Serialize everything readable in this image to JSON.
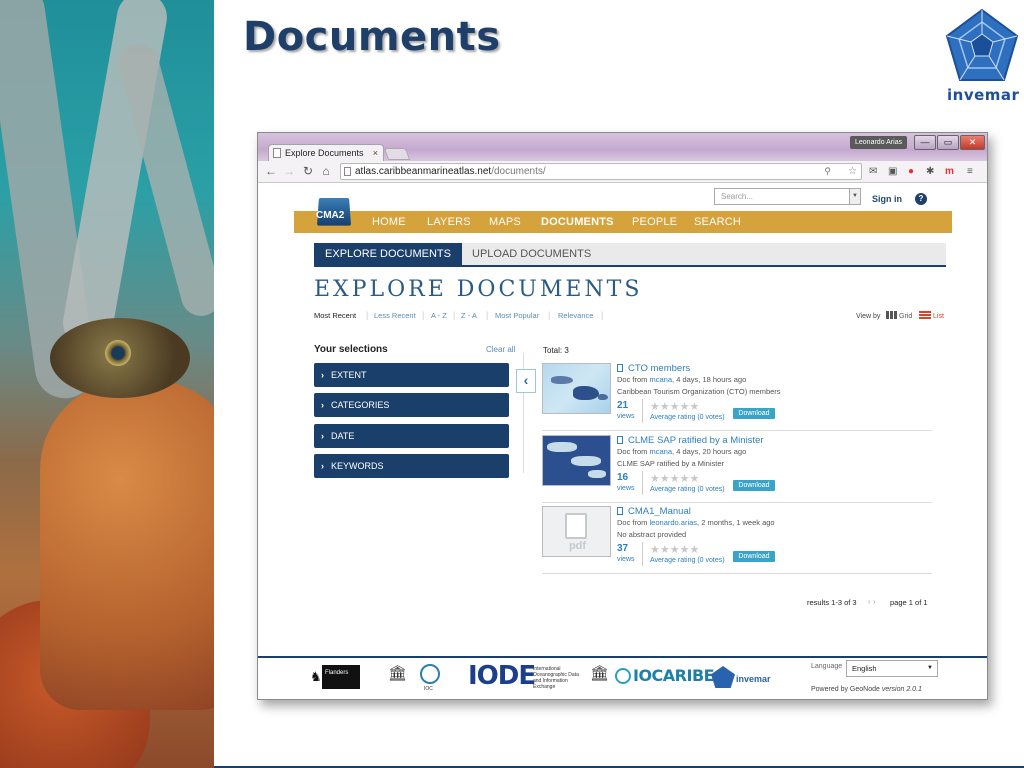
{
  "slide": {
    "title": "Documents",
    "logo_text": "invemar"
  },
  "browser": {
    "user_badge": "Leonardo Arias",
    "tab_title": "Explore Documents",
    "tab_close": "×",
    "url_host": "atlas.caribbeanmarineatlas.net",
    "url_path": "/documents/",
    "window_buttons": {
      "minimize": "—",
      "maximize": "▭",
      "close": "✕"
    }
  },
  "site": {
    "search_placeholder": "Search...",
    "sign_in": "Sign in",
    "help": "?",
    "brand": "CMA2",
    "nav": [
      "HOME",
      "LAYERS",
      "MAPS",
      "DOCUMENTS",
      "PEOPLE",
      "SEARCH"
    ],
    "active_nav": "DOCUMENTS"
  },
  "tabs": {
    "explore": "EXPLORE DOCUMENTS",
    "upload": "UPLOAD DOCUMENTS"
  },
  "page_title": "EXPLORE DOCUMENTS",
  "sort": {
    "options": [
      "Most Recent",
      "Less Recent",
      "A - Z",
      "Z - A",
      "Most Popular",
      "Relevance"
    ],
    "active": "Most Recent",
    "view_by": "View by",
    "grid": "Grid",
    "list": "List"
  },
  "filters": {
    "title": "Your selections",
    "clear_all": "Clear all",
    "facets": [
      "EXTENT",
      "CATEGORIES",
      "DATE",
      "KEYWORDS"
    ]
  },
  "results": {
    "total": "Total: 3",
    "items": [
      {
        "title": "CTO members",
        "meta_prefix": "Doc from ",
        "user": "mcana",
        "meta_suffix": ", 4 days, 18 hours ago",
        "abstract": "Caribbean Tourism Organization (CTO) members",
        "views": "21",
        "views_label": "views",
        "stars": "★★★★★",
        "rating": "Average rating (0 votes)",
        "download": "Download"
      },
      {
        "title": "CLME SAP ratified by a Minister",
        "meta_prefix": "Doc from ",
        "user": "mcana",
        "meta_suffix": ", 4 days, 20 hours ago",
        "abstract": "CLME SAP ratified by a Minister",
        "views": "16",
        "views_label": "views",
        "stars": "★★★★★",
        "rating": "Average rating (0 votes)",
        "download": "Download"
      },
      {
        "title": "CMA1_Manual",
        "meta_prefix": "Doc from ",
        "user": "leonardo.arias",
        "meta_suffix": ", 2 months, 1 week ago",
        "abstract": "No abstract provided",
        "views": "37",
        "views_label": "views",
        "stars": "★★★★★",
        "rating": "Average rating (0 votes)",
        "download": "Download",
        "thumb_label": "pdf"
      }
    ],
    "range": "results 1-3 of 3",
    "pager": "‹  ›",
    "page_of": "page 1 of 1"
  },
  "footer": {
    "flanders": "Flanders",
    "ioc": "IOC",
    "iode": "IODE",
    "iode_sub": "International Oceanographic Data and Information Exchange",
    "iocaribe": "IOCARIBE",
    "invemar": "invemar",
    "language_label": "Language",
    "language_value": "English",
    "powered_prefix": "Powered by GeoNode ",
    "powered_version": "version 2.0.1"
  }
}
